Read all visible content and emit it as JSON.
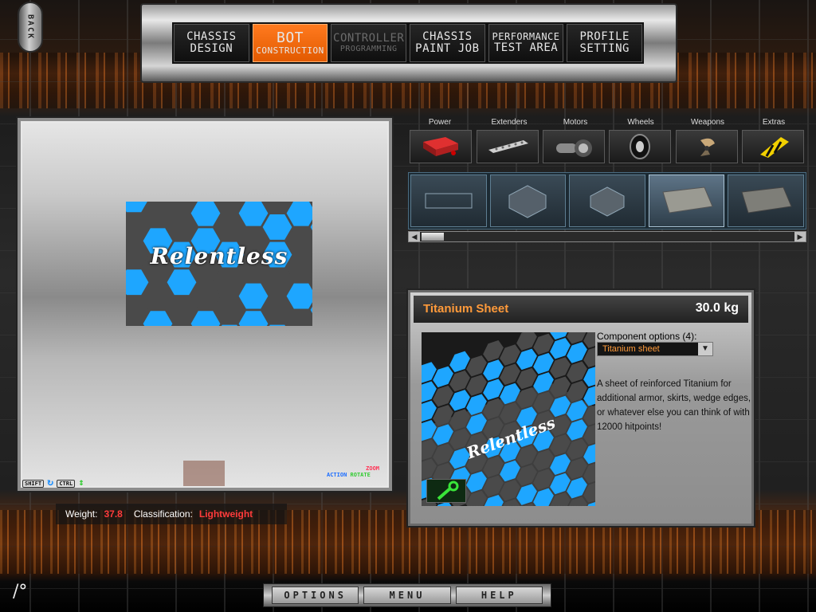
{
  "back_label": "BACK",
  "nav": [
    {
      "line1": "CHASSIS",
      "line2": "DESIGN",
      "state": "normal"
    },
    {
      "line1": "BOT",
      "line2": "CONSTRUCTION",
      "state": "active"
    },
    {
      "line1": "CONTROLLER",
      "line2": "PROGRAMMING",
      "state": "disabled"
    },
    {
      "line1": "CHASSIS",
      "line2": "PAINT JOB",
      "state": "normal"
    },
    {
      "line1": "PERFORMANCE",
      "line2": "TEST AREA",
      "state": "normal"
    },
    {
      "line1": "PROFILE",
      "line2": "SETTING",
      "state": "normal"
    }
  ],
  "viewport": {
    "decal_text": "Relentless",
    "controls": {
      "shift": "SHIFT",
      "ctrl": "CTRL",
      "action": "ACTION",
      "zoom": "ZOOM",
      "rotate": "ROTATE"
    }
  },
  "status": {
    "weight_label": "Weight:",
    "weight_value": "37.8",
    "class_label": "Classification:",
    "class_value": "Lightweight"
  },
  "categories": [
    {
      "label": "Power",
      "icon": "battery-icon"
    },
    {
      "label": "Extenders",
      "icon": "extender-bar-icon"
    },
    {
      "label": "Motors",
      "icon": "motor-icon"
    },
    {
      "label": "Wheels",
      "icon": "wheel-icon"
    },
    {
      "label": "Weapons",
      "icon": "blade-icon"
    },
    {
      "label": "Extras",
      "icon": "hazard-stripes-icon"
    }
  ],
  "parts": [
    {
      "icon": "thin-sheet-icon",
      "selected": false
    },
    {
      "icon": "hex-plate-icon",
      "selected": false
    },
    {
      "icon": "hex-plate-icon",
      "selected": false
    },
    {
      "icon": "titanium-sheet-icon",
      "selected": true
    },
    {
      "icon": "mesh-sheet-icon",
      "selected": false
    }
  ],
  "scroll": {
    "left_icon": "◀",
    "right_icon": "▶"
  },
  "detail": {
    "name": "Titanium Sheet",
    "weight": "30.0 kg",
    "options_label": "Component options (4):",
    "selected_option": "Titanium sheet",
    "description": "A sheet of reinforced Titanium for additional armor, skirts, wedge edges, or whatever else you can think of with 12000 hitpoints!"
  },
  "bottom_menu": [
    "OPTIONS",
    "MENU",
    "HELP"
  ],
  "colors": {
    "accent_orange": "#e25a00",
    "hex_blue": "#1ea6ff",
    "hex_grey": "#4a4a4a",
    "warning_red": "#ff3b3b"
  }
}
